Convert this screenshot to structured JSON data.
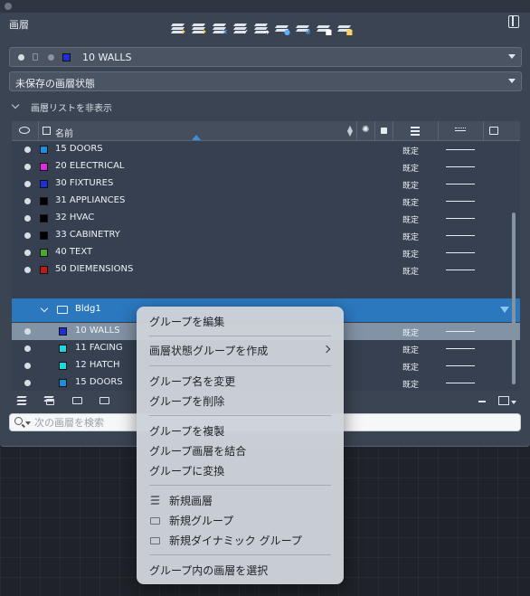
{
  "panel": {
    "title": "画層"
  },
  "toolbar": {
    "buttons": [
      "new-layer-icon",
      "new-layer-vp-frozen-icon",
      "delete-layer-icon",
      "set-current-icon",
      "layer-walk-icon",
      "layer-isolate-icon",
      "layer-freeze-icon",
      "layer-lock-icon",
      "layer-unlock-icon"
    ]
  },
  "current_layer": {
    "name": "10 WALLS",
    "color": "#1c2fd8"
  },
  "layer_state": {
    "label": "未保存の画層状態"
  },
  "list_toggle": {
    "label": "画層リストを非表示"
  },
  "list": {
    "header_name": "名前",
    "rows": [
      {
        "name": "15 DOORS",
        "color": "#1a8fe0",
        "plot": "既定"
      },
      {
        "name": "20 ELECTRICAL",
        "color": "#e02ae0",
        "plot": "既定"
      },
      {
        "name": "30 FIXTURES",
        "color": "#1c2fd8",
        "plot": "既定"
      },
      {
        "name": "31 APPLIANCES",
        "color": "#000000",
        "plot": "既定"
      },
      {
        "name": "32 HVAC",
        "color": "#000000",
        "plot": "既定"
      },
      {
        "name": "33 CABINETRY",
        "color": "#000000",
        "plot": "既定"
      },
      {
        "name": "40 TEXT",
        "color": "#48a830",
        "plot": "既定"
      },
      {
        "name": "50 DIEMENSIONS",
        "color": "#c01a1a",
        "plot": "既定"
      }
    ],
    "group": {
      "name": "Bldg1",
      "rows": [
        {
          "name": "10 WALLS",
          "color": "#1c2fd8",
          "plot": "既定",
          "selected": true
        },
        {
          "name": "11 FACING",
          "color": "#1ad8e0",
          "plot": "既定"
        },
        {
          "name": "12 HATCH",
          "color": "#1ad8e0",
          "plot": "既定"
        },
        {
          "name": "15 DOORS",
          "color": "#1a8fe0",
          "plot": "既定"
        }
      ]
    }
  },
  "search": {
    "placeholder": "次の画層を検索",
    "value": ""
  },
  "context_menu": {
    "edit_group": "グループを編集",
    "create_state_group": "画層状態グループを作成",
    "rename_group": "グループ名を変更",
    "delete_group": "グループを削除",
    "duplicate_group": "グループを複製",
    "merge_group_layers": "グループ画層を結合",
    "convert_to_group": "グループに変換",
    "new_layer": "新規画層",
    "new_group": "新規グループ",
    "new_dynamic_group": "新規ダイナミック グループ",
    "select_layers_in_group": "グループ内の画層を選択"
  }
}
